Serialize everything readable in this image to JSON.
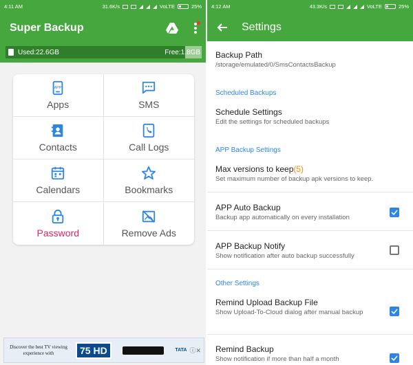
{
  "left": {
    "status": {
      "time": "4:11 AM",
      "speed": "31.6K/s",
      "network": "VoLTE",
      "battery": "25%"
    },
    "app_title": "Super Backup",
    "storage": {
      "used": "Used:22.6GB",
      "free": "Free:1.8GB"
    },
    "grid": [
      {
        "label": "Apps",
        "icon": "apps-icon"
      },
      {
        "label": "SMS",
        "icon": "sms-icon"
      },
      {
        "label": "Contacts",
        "icon": "contacts-icon"
      },
      {
        "label": "Call Logs",
        "icon": "call-logs-icon"
      },
      {
        "label": "Calendars",
        "icon": "calendar-icon"
      },
      {
        "label": "Bookmarks",
        "icon": "star-icon"
      },
      {
        "label": "Password",
        "icon": "lock-icon"
      },
      {
        "label": "Remove Ads",
        "icon": "no-ads-icon"
      }
    ],
    "ad": {
      "text": "Discover the best TV viewing experience with",
      "badge": "75 HD",
      "brand": "TATA"
    }
  },
  "right": {
    "status": {
      "time": "4:12 AM",
      "speed": "43.3K/s",
      "network": "VoLTE",
      "battery": "25%"
    },
    "title": "Settings",
    "backup_path": {
      "title": "Backup Path",
      "summary": "/storage/emulated/0/SmsContactsBackup"
    },
    "section_scheduled": "Scheduled Backups",
    "schedule_settings": {
      "title": "Schedule Settings",
      "summary": "Edit the settings for scheduled backups"
    },
    "section_app": "APP Backup Settings",
    "max_versions": {
      "title": "Max versions to keep",
      "value": "(5)",
      "summary": "Set maximum number of backup apk versions to keep."
    },
    "auto_backup": {
      "title": "APP Auto Backup",
      "summary": "Backup app automatically on every installation",
      "checked": true
    },
    "backup_notify": {
      "title": "APP Backup Notify",
      "summary": "Show notification after auto backup successfully",
      "checked": false
    },
    "section_other": "Other Settings",
    "remind_upload": {
      "title": "Remind Upload Backup File",
      "summary": "Show Upload-To-Cloud dialog after manual backup",
      "checked": true
    },
    "remind_backup": {
      "title": "Remind Backup",
      "summary": "Show notification if more than half a month",
      "checked": true
    }
  },
  "colors": {
    "primary": "#46a73e",
    "accent_blue": "#2f86e0",
    "password_red": "#e0245e",
    "value_orange": "#f08c00"
  }
}
